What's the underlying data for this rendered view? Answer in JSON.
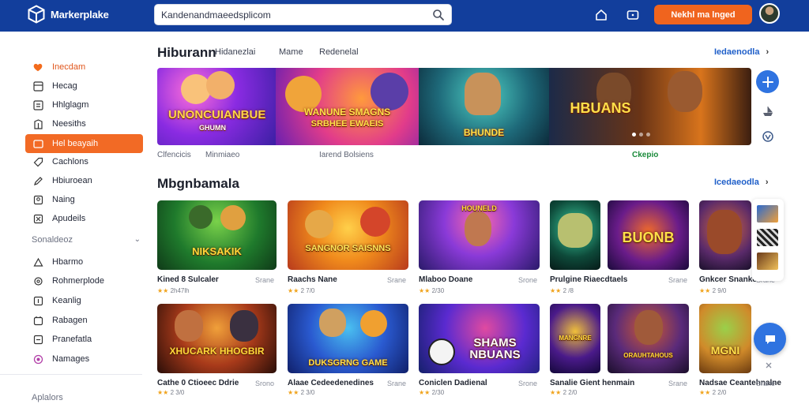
{
  "header": {
    "logo_text": "Markerplake",
    "search_value": "Kandenandmaeedsplicom",
    "cta_label": "Nekhl ma lnged",
    "icons": [
      "cube-logo-icon",
      "search-icon",
      "home-icon",
      "chat-icon",
      "avatar"
    ]
  },
  "sidebar": {
    "items": [
      {
        "label": "Inecdam",
        "icon": "heart-icon",
        "state": "highlight"
      },
      {
        "label": "Hecag",
        "icon": "store-icon"
      },
      {
        "label": "Hhlglagm",
        "icon": "grid-icon"
      },
      {
        "label": "Neesiths",
        "icon": "news-icon"
      },
      {
        "label": "Hel beayaih",
        "icon": "folder-icon",
        "state": "active"
      },
      {
        "label": "Cachlons",
        "icon": "tag-icon"
      },
      {
        "label": "Hbiuroean",
        "icon": "pen-icon"
      },
      {
        "label": "Naing",
        "icon": "user-icon"
      },
      {
        "label": "Apudeils",
        "icon": "box-icon"
      }
    ],
    "section_label": "Sonaldeoz",
    "section_items": [
      {
        "label": "Hbarmo",
        "icon": "triangle-icon"
      },
      {
        "label": "Rohmerplode",
        "icon": "gear-icon"
      },
      {
        "label": "Keanlig",
        "icon": "lock-icon"
      },
      {
        "label": "Rabagen",
        "icon": "wallet-icon"
      },
      {
        "label": "Pranefatla",
        "icon": "card-icon"
      },
      {
        "label": "Namages",
        "icon": "circle-icon"
      }
    ],
    "footer_label": "Aplalors"
  },
  "featured": {
    "title": "Hiburann",
    "tabs": [
      "Hidanezlai",
      "Mame",
      "Redenelal"
    ],
    "see_all": "Iedaenodla",
    "slides": [
      {
        "art_text": "UNONCUIANBUE",
        "sub": "GHUMN"
      },
      {
        "art_text": "WANUNE SMAGNS",
        "sub": "SRBHEE EWAEIS"
      },
      {
        "art_text": "BHUNDE",
        "sub": ""
      },
      {
        "art_text": "HBUANS",
        "sub": ""
      }
    ],
    "captions": [
      "Clfencicis",
      "Minmiaeo",
      "Iarend Bolsiens",
      "Ckepio"
    ]
  },
  "popular": {
    "title": "Mbgnbamala",
    "see_all": "Icedaeodla",
    "cards": [
      {
        "title": "Kined 8 Sulcaler",
        "price": "Srane",
        "rating": "★★ 2h47lh",
        "art": "NIKSAKIK"
      },
      {
        "title": "Raachs Nane",
        "price": "Srane",
        "rating": "★★ 2 7/0",
        "art": "SANGNOR SAISNNS"
      },
      {
        "title": "Mlaboo Doane",
        "price": "Srone",
        "rating": "★★ 2/30",
        "art": "HOUNELD"
      },
      {
        "title": "Prulgine Riaecdtaels",
        "price": "Srane",
        "rating": "★★ 2 /8",
        "art": ""
      },
      {
        "title": "",
        "price": "",
        "rating": "",
        "art": "BUONB"
      },
      {
        "title": "Gnkcer Snanke",
        "price": "Srane",
        "rating": "★★ 2 9/0",
        "art": ""
      },
      {
        "title": "Cathe 0 Ctioeec Ddrie",
        "price": "Srono",
        "rating": "★★ 2 3/0",
        "art": "XHUCARK HHOGBIR"
      },
      {
        "title": "Alaae Cedeedenedines",
        "price": "Srane",
        "rating": "★★ 2 3/0",
        "art": "DUKSGRNG GAME"
      },
      {
        "title": "Coniclen Dadienal",
        "price": "Srone",
        "rating": "★★ 2/30",
        "art": "SHAMS NBUANS"
      },
      {
        "title": "Sanalie Gient henmain",
        "price": "Srane",
        "rating": "★★ 2 2/0",
        "art": "MANGNRE"
      },
      {
        "title": "",
        "price": "",
        "rating": "",
        "art": "ORAUHTAHOUS"
      },
      {
        "title": "Nadsae Ceantehnalne",
        "price": "Srane",
        "rating": "★★ 2 2/0",
        "art": "MGNI"
      }
    ]
  },
  "colors": {
    "header_bg": "#123e9c",
    "accent_orange": "#f26a25",
    "link_blue": "#1f5fc9",
    "fab_blue": "#2f73e0"
  }
}
